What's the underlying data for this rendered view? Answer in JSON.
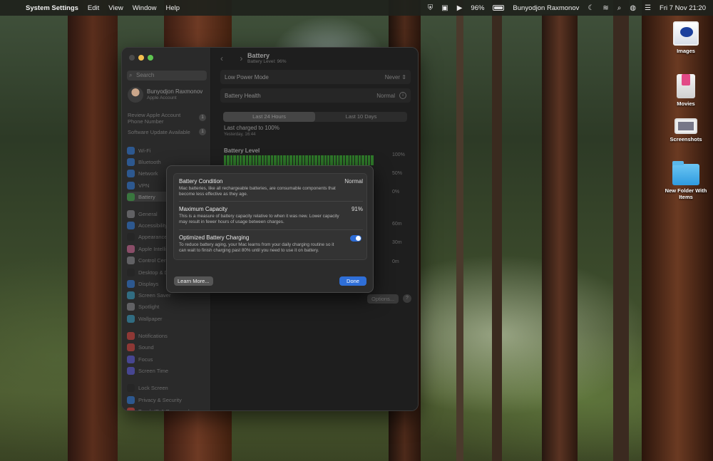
{
  "menubar": {
    "app_name": "System Settings",
    "menus": [
      "Edit",
      "View",
      "Window",
      "Help"
    ],
    "battery_percent": "96%",
    "user_name": "Bunyodjon Raxmonov",
    "datetime": "Fri 7 Nov  21:20"
  },
  "desktop": {
    "icons": [
      {
        "label": "Images",
        "icon": "images-folder-icon"
      },
      {
        "label": "Movies",
        "icon": "movies-folder-icon"
      },
      {
        "label": "Screenshots",
        "icon": "screenshots-folder-icon"
      },
      {
        "label": "New Folder With Items",
        "icon": "folder-icon"
      }
    ]
  },
  "sidebar": {
    "search_placeholder": "Search",
    "account_name": "Bunyodjon Raxmonov",
    "account_sub": "Apple Account",
    "review_line1": "Review Apple Account",
    "review_line2": "Phone Number",
    "review_badge": "1",
    "software_update": "Software Update Available",
    "software_badge": "1",
    "items": [
      {
        "label": "Wi-Fi",
        "color": "#2f7de1"
      },
      {
        "label": "Bluetooth",
        "color": "#2f7de1"
      },
      {
        "label": "Network",
        "color": "#2f7de1"
      },
      {
        "label": "VPN",
        "color": "#2f7de1"
      },
      {
        "label": "Battery",
        "color": "#38a842"
      },
      {
        "label": "General",
        "color": "#8e8e93"
      },
      {
        "label": "Accessibility",
        "color": "#2f7de1"
      },
      {
        "label": "Appearance",
        "color": "#222222"
      },
      {
        "label": "Apple Intelligence",
        "color": "#d96a9a"
      },
      {
        "label": "Control Centre",
        "color": "#8e8e93"
      },
      {
        "label": "Desktop & Dock",
        "color": "#222222"
      },
      {
        "label": "Displays",
        "color": "#2f7de1"
      },
      {
        "label": "Screen Saver",
        "color": "#36a2c9"
      },
      {
        "label": "Spotlight",
        "color": "#8e8e93"
      },
      {
        "label": "Wallpaper",
        "color": "#36a2c9"
      },
      {
        "label": "Notifications",
        "color": "#e0443e"
      },
      {
        "label": "Sound",
        "color": "#e0443e"
      },
      {
        "label": "Focus",
        "color": "#5e5ce6"
      },
      {
        "label": "Screen Time",
        "color": "#5e5ce6"
      },
      {
        "label": "Lock Screen",
        "color": "#222222"
      },
      {
        "label": "Privacy & Security",
        "color": "#2f7de1"
      },
      {
        "label": "Touch ID & Password",
        "color": "#e0443e"
      }
    ]
  },
  "battery_page": {
    "title": "Battery",
    "subtitle": "Battery Level: 96%",
    "low_power_label": "Low Power Mode",
    "low_power_value": "Never",
    "health_label": "Battery Health",
    "health_value": "Normal",
    "tabs": [
      "Last 24 Hours",
      "Last 10 Days"
    ],
    "last_charged": "Last charged to 100%",
    "last_charged_time": "Yesterday, 16:44",
    "level_title": "Battery Level",
    "pct_labels": [
      "100%",
      "50%",
      "0%"
    ],
    "time_labels": [
      "60m",
      "30m",
      "0m"
    ],
    "options_label": "Options...",
    "help_label": "?"
  },
  "sheet": {
    "condition_title": "Battery Condition",
    "condition_value": "Normal",
    "condition_desc": "Mac batteries, like all rechargeable batteries, are consumable components that become less effective as they age.",
    "capacity_title": "Maximum Capacity",
    "capacity_value": "91%",
    "capacity_desc": "This is a measure of battery capacity relative to when it was new. Lower capacity may result in fewer hours of usage between charges.",
    "optimized_title": "Optimized Battery Charging",
    "optimized_on": true,
    "optimized_desc": "To reduce battery aging, your Mac learns from your daily charging routine so it can wait to finish charging past 80% until you need to use it on battery.",
    "learn_more": "Learn More...",
    "done": "Done"
  }
}
